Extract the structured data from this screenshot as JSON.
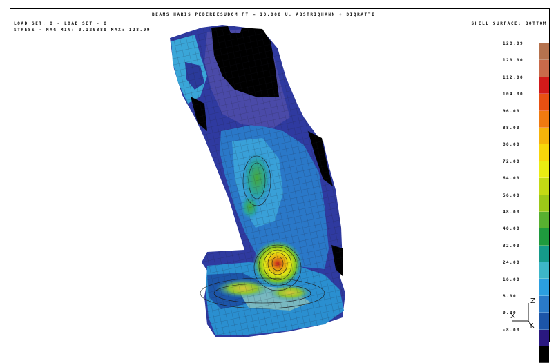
{
  "header": {
    "title": "BEAMS HARIS PEDERBESUDOM FT = 10.000 U. ABSTRIQHANN + DIQRATTI",
    "line1": "LOAD SET:   8 -   LOAD SET -        8",
    "line2": "STRESS - MAG MIN: 0.129380 MAX: 128.09",
    "surface": "SHELL SURFACE: BOTTOM"
  },
  "legend": {
    "labels": [
      "128.09",
      "120.00",
      "112.00",
      "104.00",
      "96.00",
      "88.00",
      "80.00",
      "72.00",
      "64.00",
      "56.00",
      "48.00",
      "40.00",
      "32.00",
      "24.00",
      "16.00",
      "8.00",
      "0.00",
      "-8.00"
    ],
    "colors": [
      "#b5724e",
      "#c96a4a",
      "#d21a1a",
      "#e85012",
      "#f07a10",
      "#f6b30a",
      "#f8d60a",
      "#eaec12",
      "#c4da14",
      "#9cc818",
      "#58b030",
      "#1f9a3e",
      "#159a8a",
      "#3db6c8",
      "#2b9fe0",
      "#2a7ac8",
      "#1c55a8",
      "#2a1880",
      "#000000"
    ]
  },
  "axis": {
    "z": "Z",
    "x": "X",
    "y": "Y"
  },
  "colors": {
    "background": "#ffffff",
    "mesh": "#1b1b2e",
    "void": "#000000"
  }
}
